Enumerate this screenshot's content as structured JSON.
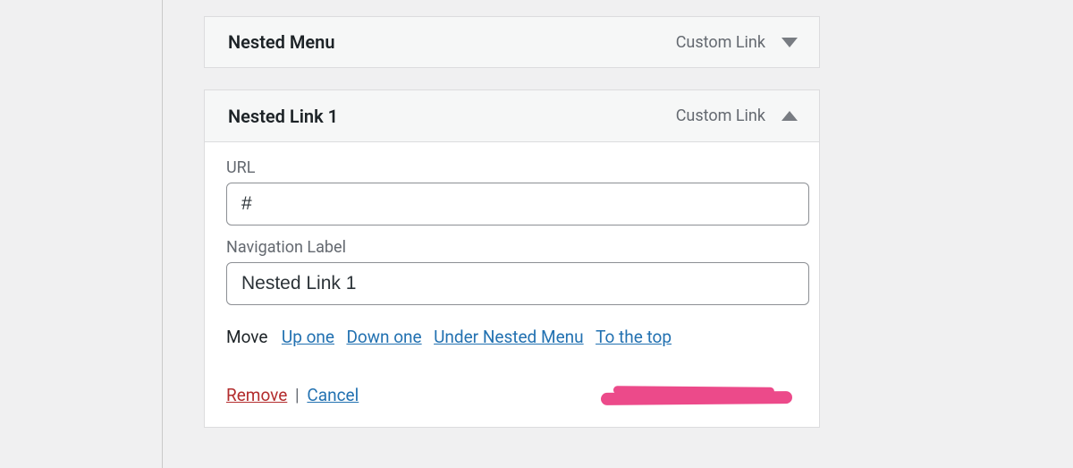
{
  "collapsed_item": {
    "title": "Nested Menu",
    "type": "Custom Link"
  },
  "expanded_item": {
    "title": "Nested Link 1",
    "type": "Custom Link",
    "url_label": "URL",
    "url_value": "#",
    "nav_label_label": "Navigation Label",
    "nav_label_value": "Nested Link 1",
    "move_label": "Move",
    "move_links": {
      "up": "Up one",
      "down": "Down one",
      "under": "Under Nested Menu",
      "top": "To the top"
    },
    "remove": "Remove",
    "sep": "|",
    "cancel": "Cancel"
  }
}
